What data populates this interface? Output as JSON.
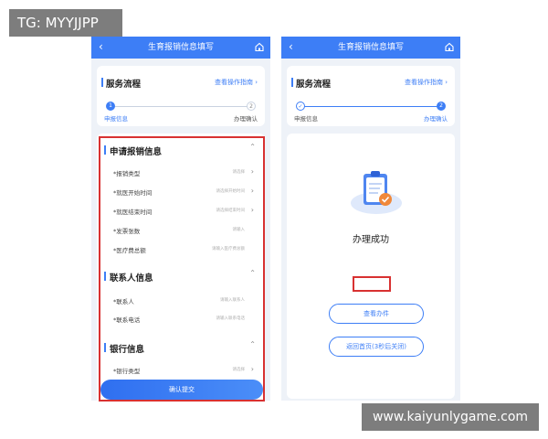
{
  "overlay_tag": "TG: MYYJJPP",
  "overlay_url": "www.kaiyunlygame.com",
  "colors": {
    "primary": "#3d7ef6",
    "highlight": "#d83131",
    "background": "#eef2f8"
  },
  "left": {
    "titlebar": {
      "title": "生育报销信息填写",
      "back": "‹"
    },
    "flow": {
      "title": "服务流程",
      "guide": "查看操作指南 ›",
      "steps": [
        {
          "num": "1",
          "label": "申报信息"
        },
        {
          "num": "2",
          "label": "办理确认"
        }
      ]
    },
    "sections": [
      {
        "title": "申请报销信息",
        "fields": [
          {
            "label": "*报销类型",
            "placeholder": "请选择",
            "arrow": "›"
          },
          {
            "label": "*就医开始时间",
            "placeholder": "请选择开始时间",
            "arrow": "›"
          },
          {
            "label": "*就医结束时间",
            "placeholder": "请选择结束时间",
            "arrow": "›"
          },
          {
            "label": "*发票张数",
            "placeholder": "请输入",
            "arrow": ""
          },
          {
            "label": "*医疗费总额",
            "placeholder": "请输入医疗费总额",
            "arrow": ""
          }
        ]
      },
      {
        "title": "联系人信息",
        "fields": [
          {
            "label": "*联系人",
            "placeholder": "请输入联系人",
            "arrow": ""
          },
          {
            "label": "*联系电话",
            "placeholder": "请输入联系电话",
            "arrow": ""
          }
        ]
      },
      {
        "title": "银行信息",
        "fields": [
          {
            "label": "*银行类型",
            "placeholder": "请选择",
            "arrow": "›"
          }
        ]
      }
    ],
    "submit_label": "确认提交"
  },
  "right": {
    "titlebar": {
      "title": "生育报销信息填写",
      "back": "‹"
    },
    "flow": {
      "title": "服务流程",
      "guide": "查看操作指南 ›",
      "steps": [
        {
          "num": "✓",
          "label": "申报信息"
        },
        {
          "num": "2",
          "label": "办理确认"
        }
      ]
    },
    "success_text": "办理成功",
    "view_button": "查看办件",
    "home_button": "返回首页(3秒后关闭)"
  }
}
